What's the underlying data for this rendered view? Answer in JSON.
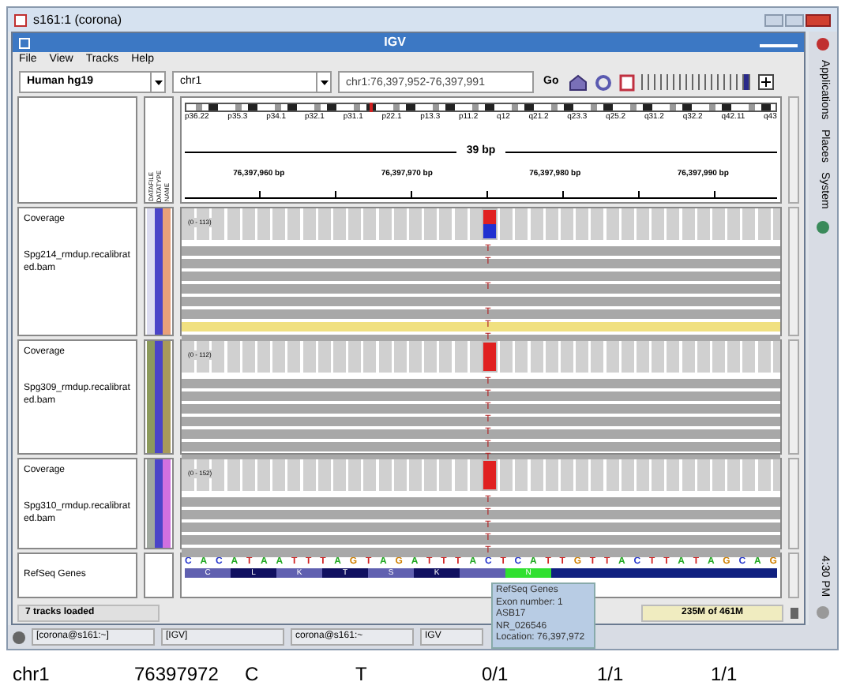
{
  "outer_window": {
    "title": "s161:1 (corona)"
  },
  "window": {
    "title": "IGV"
  },
  "menu": [
    "File",
    "View",
    "Tracks",
    "Help"
  ],
  "toolbar": {
    "genome": "Human hg19",
    "chromosome": "chr1",
    "locus": "chr1:76,397,952-76,397,991",
    "go": "Go",
    "zoom": {
      "level": 0.97
    }
  },
  "header": {
    "attributes": [
      "DATAFILE",
      "DATATYPE",
      "NAME"
    ],
    "bands": [
      "p36.22",
      "p35.3",
      "p34.1",
      "p32.1",
      "p31.1",
      "p22.1",
      "p13.3",
      "p11.2",
      "q12",
      "q21.2",
      "q23.3",
      "q25.2",
      "q31.2",
      "q32.2",
      "q42.11",
      "q43"
    ],
    "span": "39 bp",
    "ticks": [
      "76,397,960 bp",
      "76,397,970 bp",
      "76,397,980 bp",
      "76,397,990 bp"
    ]
  },
  "tracks": [
    {
      "coverage_label": "Coverage",
      "name": "Spg214_rmdup.recalibrated.bam",
      "range": "(0 - 113)",
      "level": 0.5,
      "attributes": [
        {
          "color": "#dcdcf0"
        },
        {
          "color": "#4a44c8"
        },
        {
          "color": "#e8a07a"
        }
      ],
      "reads": [
        {
          "mismatch": "T",
          "selected": false
        },
        {
          "mismatch": "T",
          "selected": false
        },
        {
          "selected": false
        },
        {
          "mismatch": "T",
          "selected": false
        },
        {
          "selected": false
        },
        {
          "mismatch": "T",
          "selected": false
        },
        {
          "mismatch": "T",
          "selected": true
        },
        {
          "mismatch": "T",
          "selected": false
        }
      ]
    },
    {
      "coverage_label": "Coverage",
      "name": "Spg309_rmdup.recalibrated.bam",
      "range": "(0 - 112)",
      "level": 1,
      "attributes": [
        {
          "color": "#8c9a5c"
        },
        {
          "color": "#4a44c8"
        },
        {
          "color": "#a89a5a"
        }
      ],
      "reads": [
        {
          "mismatch": "T",
          "selected": false
        },
        {
          "mismatch": "T",
          "selected": false
        },
        {
          "mismatch": "T",
          "selected": false
        },
        {
          "mismatch": "T",
          "selected": false
        },
        {
          "mismatch": "T",
          "selected": false
        },
        {
          "mismatch": "T",
          "selected": false
        },
        {
          "mismatch": "T",
          "selected": false
        }
      ]
    },
    {
      "coverage_label": "Coverage",
      "name": "Spg310_rmdup.recalibrated.bam",
      "range": "(0 - 152)",
      "level": 1,
      "attributes": [
        {
          "color": "#a0a8a0"
        },
        {
          "color": "#4a44c8"
        },
        {
          "color": "#d070e0"
        }
      ],
      "reads": [
        {
          "mismatch": "T",
          "selected": false
        },
        {
          "mismatch": "T",
          "selected": false
        },
        {
          "mismatch": "T",
          "selected": false
        },
        {
          "mismatch": "T",
          "selected": false
        },
        {
          "mismatch": "T",
          "selected": false
        }
      ]
    }
  ],
  "refseq": {
    "label": "RefSeq Genes",
    "sequence": [
      "C",
      "A",
      "C",
      "A",
      "T",
      "A",
      "A",
      "T",
      "T",
      "T",
      "A",
      "G",
      "T",
      "A",
      "G",
      "A",
      "T",
      "T",
      "T",
      "A",
      "C",
      "T",
      "C",
      "A",
      "T",
      "T",
      "G",
      "T",
      "T",
      "A",
      "C",
      "T",
      "T",
      "A",
      "T",
      "A",
      "G",
      "C",
      "A",
      "G"
    ],
    "amino_acids": [
      {
        "label": "C",
        "color": "#6060b0"
      },
      {
        "label": "L",
        "color": "#101060"
      },
      {
        "label": "K",
        "color": "#6060b0"
      },
      {
        "label": "T",
        "color": "#101060"
      },
      {
        "label": "S",
        "color": "#6060b0"
      },
      {
        "label": "K",
        "color": "#101060"
      },
      {
        "color": "#6060b0"
      },
      {
        "label": "N",
        "color": "#30e030"
      }
    ]
  },
  "tooltip": [
    "RefSeq Genes",
    "Exon number: 1",
    "ASB17",
    "NR_026546",
    "Location: 76,397,972"
  ],
  "status_bar": {
    "message": "7 tracks loaded",
    "memory": "235M of 461M"
  },
  "side_panel": [
    "Applications",
    "Places",
    "System",
    "4:30 PM"
  ],
  "taskbar": [
    "[corona@s161:~]",
    "[IGV]",
    "corona@s161:~",
    "IGV"
  ],
  "caption": [
    "chr1",
    "76397972",
    "C",
    "T",
    "0/1",
    "1/1",
    "1/1"
  ]
}
